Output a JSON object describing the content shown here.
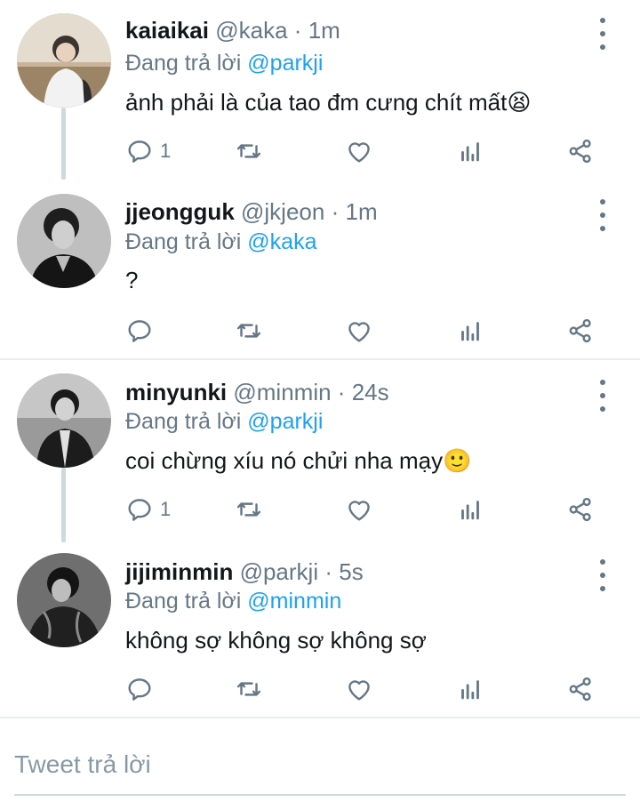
{
  "tweets": [
    {
      "name": "kaiaikai",
      "handle": "@kaka",
      "time": "1m",
      "replying_prefix": "Đang trả lời",
      "replying_to": "@parkji",
      "text": "ảnh phải là của tao đm cưng chít mất",
      "emoji": "😫",
      "reply_count": "1",
      "avatar_icon": "avatar-photo"
    },
    {
      "name": "jjeongguk",
      "handle": "@jkjeon",
      "time": "1m",
      "replying_prefix": "Đang trả lời",
      "replying_to": "@kaka",
      "text": "?",
      "emoji": "",
      "reply_count": "",
      "avatar_icon": "avatar-photo"
    },
    {
      "name": "minyunki",
      "handle": "@minmin",
      "time": "24s",
      "replying_prefix": "Đang trả lời",
      "replying_to": "@parkji",
      "text": "coi chừng xíu nó chửi nha mạy",
      "emoji": "🙂",
      "reply_count": "1",
      "avatar_icon": "avatar-photo"
    },
    {
      "name": "jijiminmin",
      "handle": "@parkji",
      "time": "5s",
      "replying_prefix": "Đang trả lời",
      "replying_to": "@minmin",
      "text": "không sợ không sợ không sợ",
      "emoji": "",
      "reply_count": "",
      "avatar_icon": "avatar-photo"
    }
  ],
  "separator": "·",
  "reply_box": {
    "placeholder": "Tweet trả lời"
  },
  "icons": {
    "reply": "reply-icon",
    "retweet": "retweet-icon",
    "like": "heart-icon",
    "analytics": "analytics-icon",
    "share": "share-icon",
    "more": "more-vertical-icon"
  },
  "colors": {
    "text": "#14171a",
    "secondary": "#657786",
    "link": "#1da1f2",
    "divider": "#e6ecf0",
    "connector": "#cfd9de"
  }
}
